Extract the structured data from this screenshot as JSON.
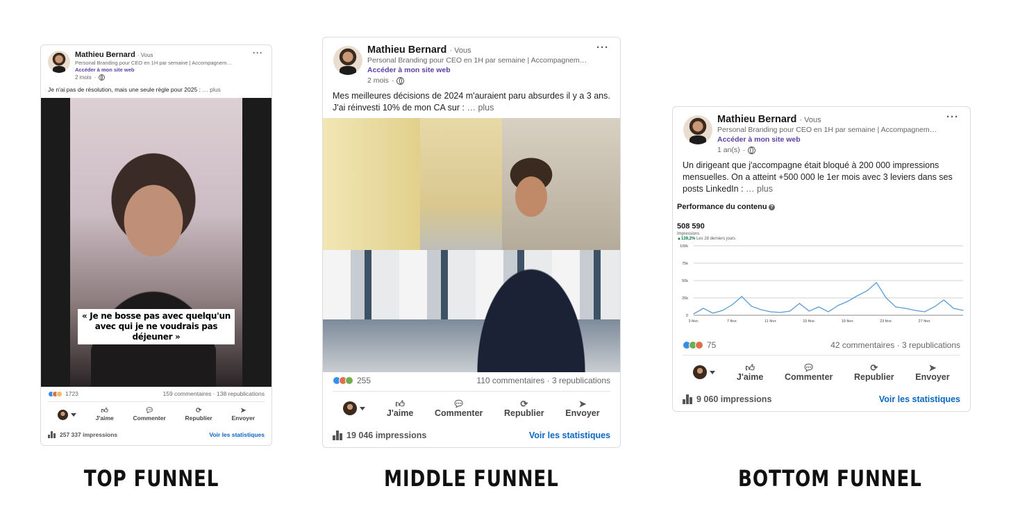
{
  "posts": [
    {
      "author": "Mathieu Bernard",
      "you": "· Vous",
      "tagline": "Personal Branding pour CEO en 1H par semaine | Accompagnem…",
      "site_link": "Accéder à mon site web",
      "age": "2 mois",
      "text": "Je n'ai pas de résolution, mais une seule règle pour 2025 :",
      "more": "… plus",
      "video_caption": "« Je ne bosse pas avec quelqu'un\navec qui je ne voudrais pas\ndéjeuner »",
      "reactions": "1723",
      "comments": "159 commentaires",
      "reposts": "138 republications",
      "actions": [
        "J'aime",
        "Commenter",
        "Republier",
        "Envoyer"
      ],
      "impressions": "257 337 impressions",
      "stats_link": "Voir les statistiques",
      "funnel_label": "TOP FUNNEL"
    },
    {
      "author": "Mathieu Bernard",
      "you": "· Vous",
      "tagline": "Personal Branding pour CEO en 1H par semaine | Accompagnem…",
      "site_link": "Accéder à mon site web",
      "age": "2 mois",
      "text_line1": "Mes meilleures décisions de 2024 m'auraient paru absurdes il y a 3 ans.",
      "text_line2": "J'ai réinvesti 10% de mon CA sur :",
      "more": "… plus",
      "reactions": "255",
      "comments": "110 commentaires",
      "reposts": "3 republications",
      "actions": [
        "J'aime",
        "Commenter",
        "Republier",
        "Envoyer"
      ],
      "impressions": "19 046 impressions",
      "stats_link": "Voir les statistiques",
      "funnel_label": "MIDDLE FUNNEL"
    },
    {
      "author": "Mathieu Bernard",
      "you": "· Vous",
      "tagline": "Personal Branding pour CEO en 1H par semaine | Accompagnem…",
      "site_link": "Accéder à mon site web",
      "age": "1 an(s)",
      "text": "Un dirigeant que j'accompagne était bloqué à 200 000 impressions mensuelles. On a atteint +500 000 le 1er mois avec 3 leviers dans ses posts LinkedIn :",
      "more": "… plus",
      "reactions": "75",
      "comments": "42 commentaires",
      "reposts": "3 republications",
      "actions": [
        "J'aime",
        "Commenter",
        "Republier",
        "Envoyer"
      ],
      "impressions": "9 060 impressions",
      "stats_link": "Voir les statistiques",
      "funnel_label": "BOTTOM FUNNEL"
    }
  ],
  "separator": "·",
  "colors": {
    "link": "#0a66c2",
    "site_link": "#5b3fa6",
    "chart_line": "#5b9bd5"
  },
  "chart_data": {
    "type": "line",
    "title": "Performance du contenu",
    "total": "508 590",
    "total_label": "Impressions",
    "change": "▲139,2%",
    "change_note": "Les 28 derniers jours",
    "x_ticks": [
      "3 févr.",
      "7 févr.",
      "11 févr.",
      "15 févr.",
      "19 févr.",
      "23 févr.",
      "27 févr."
    ],
    "y_ticks": [
      "0",
      "25k",
      "50k",
      "75k",
      "100k"
    ],
    "ylim": [
      0,
      100000
    ],
    "x": [
      1,
      2,
      3,
      4,
      5,
      6,
      7,
      8,
      9,
      10,
      11,
      12,
      13,
      14,
      15,
      16,
      17,
      18,
      19,
      20,
      21,
      22,
      23,
      24,
      25,
      26,
      27,
      28,
      29
    ],
    "values": [
      2000,
      10000,
      3000,
      7000,
      15000,
      27000,
      13000,
      8000,
      5000,
      4000,
      6000,
      17000,
      6000,
      12000,
      5000,
      14000,
      20000,
      28000,
      35000,
      47000,
      25000,
      12000,
      10000,
      7000,
      5000,
      12000,
      22000,
      10000,
      7000
    ],
    "series_values_note": "",
    "grid": true
  }
}
